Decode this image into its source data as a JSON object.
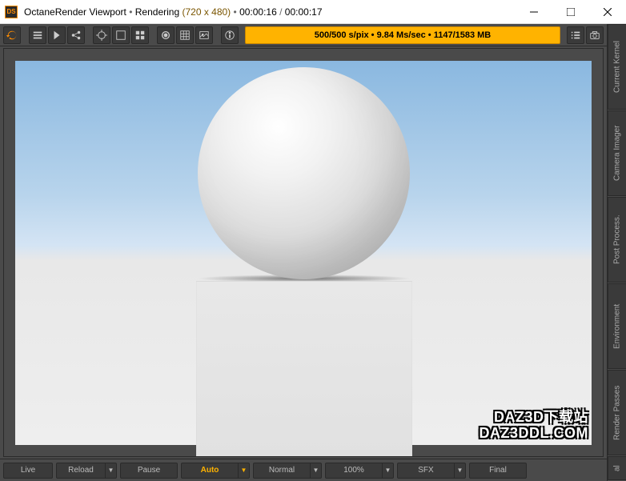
{
  "title": {
    "app": "OctaneRender Viewport",
    "status": "Rendering",
    "dimensions": "(720 x 480)",
    "time_elapsed": "00:00:16",
    "time_total": "00:00:17"
  },
  "toolbar_status": "500/500 s/pix • 9.84 Ms/sec • 1147/1583 MB",
  "bottom_buttons": {
    "live": "Live",
    "reload": "Reload",
    "pause": "Pause",
    "auto": "Auto",
    "normal": "Normal",
    "zoom": "100%",
    "sfx": "SFX",
    "final": "Final"
  },
  "side_tabs": [
    "Current Kernel",
    "Camera Imager",
    "Post Process.",
    "Environment",
    "Render Passes",
    "al"
  ],
  "watermark": {
    "line1": "DAZ3D下载站",
    "line2": "DAZ3DDL.COM"
  }
}
